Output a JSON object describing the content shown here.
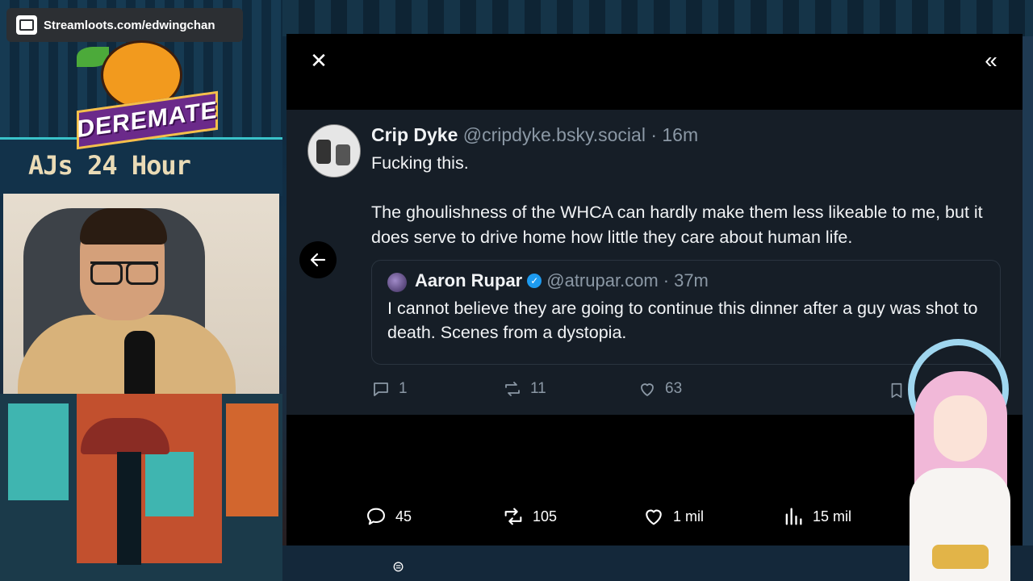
{
  "overlay": {
    "streamloots_url": "Streamloots.com/edwingchan",
    "logo_text": "DEREMATE",
    "event_text": "AJs 24 Hour"
  },
  "panel": {
    "close_label": "✕",
    "expand_label": "«"
  },
  "post": {
    "author": "Crip Dyke",
    "handle": "@cripdyke.bsky.social",
    "separator": "·",
    "time": "16m",
    "body_line1": "Fucking this.",
    "body_line2": "The ghoulishness of the WHCA can hardly make them less likeable to me, but it does serve to drive home how little they care about human life.",
    "quote": {
      "author": "Aaron Rupar",
      "verified_mark": "✓",
      "handle": "@atrupar.com",
      "separator": "·",
      "time": "37m",
      "body": "I cannot believe they are going to continue this dinner after a guy was shot to death. Scenes from a dystopia."
    },
    "embed_counts": {
      "replies": "1",
      "reposts": "11",
      "likes": "63"
    }
  },
  "bottom_actions": {
    "replies": "45",
    "reposts": "105",
    "likes": "1 mil",
    "views": "15 mil"
  },
  "icons": [
    "close-icon",
    "double-chevron-left-icon",
    "arrow-left-icon",
    "reply-icon",
    "repost-icon",
    "heart-icon",
    "bookmark-icon",
    "views-icon",
    "verified-badge-icon"
  ],
  "colors": {
    "panel_bg": "#000000",
    "embed_bg": "#161e27",
    "muted_text": "#8b98a5",
    "verified_blue": "#1d9bf0"
  }
}
